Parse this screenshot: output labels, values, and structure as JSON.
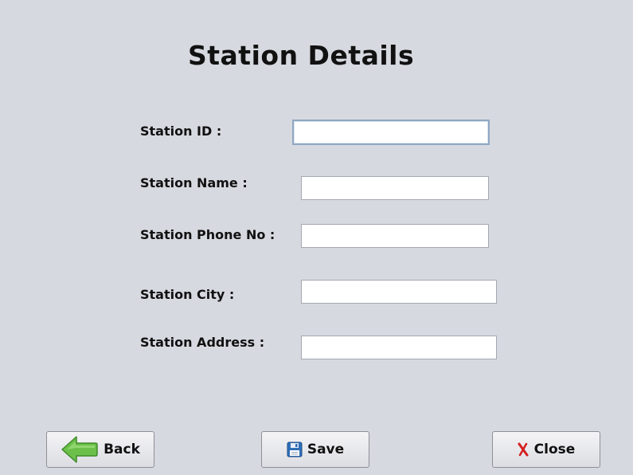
{
  "title": "Station Details",
  "form": {
    "fields": [
      {
        "label": "Station ID :",
        "value": ""
      },
      {
        "label": "Station Name :",
        "value": ""
      },
      {
        "label": "Station Phone No :",
        "value": ""
      },
      {
        "label": "Station City :",
        "value": ""
      },
      {
        "label": "Station Address :",
        "value": ""
      }
    ]
  },
  "buttons": {
    "back": {
      "label": "Back",
      "icon": "arrow-left-icon"
    },
    "save": {
      "label": "Save",
      "icon": "floppy-disk-icon"
    },
    "close": {
      "label": "Close",
      "icon": "close-x-icon"
    }
  },
  "colors": {
    "background": "#d7d9e0",
    "back_arrow": "#6cc04a",
    "save_icon": "#2f6fb8",
    "close_icon": "#d42020"
  }
}
